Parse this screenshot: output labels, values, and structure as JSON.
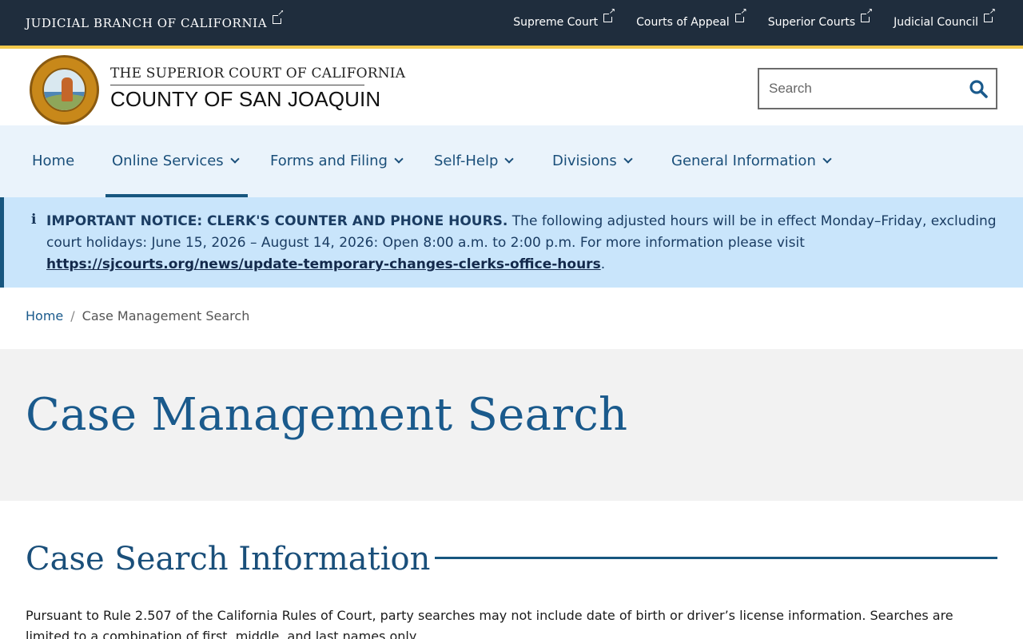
{
  "topbar": {
    "branch": "JUDICIAL BRANCH OF CALIFORNIA",
    "links": [
      "Supreme Court",
      "Courts of Appeal",
      "Superior Courts",
      "Judicial Council"
    ]
  },
  "header": {
    "court_line1": "THE SUPERIOR COURT OF CALIFORNIA",
    "court_line2": "COUNTY OF SAN JOAQUIN",
    "search_placeholder": "Search"
  },
  "nav": {
    "items": [
      "Home",
      "Online Services",
      "Forms and Filing",
      "Self-Help",
      "Divisions",
      "General Information"
    ],
    "active": "Online Services"
  },
  "alert": {
    "icon": "info-icon",
    "heading": "IMPORTANT NOTICE: CLERK'S COUNTER AND PHONE HOURS.",
    "text": " The following adjusted hours will be in effect Monday–Friday, excluding court holi­days: June 15, 2026 – August 14, 2026: Open 8:00 a.m. to 2:00 p.m. For more information please visit ",
    "link": "https://sjcourts.org/news/update-temporary-changes-clerks-office-hours",
    "tail": "."
  },
  "breadcrumb": {
    "home": "Home",
    "separator": "/",
    "current": "Case Management Search"
  },
  "page": {
    "title": "Case Management Search",
    "section_title": "Case Search Information",
    "body": "Pursuant to Rule 2.507 of the California Rules of Court, party searches may not include date of birth or driver’s license information. Searches are limited to a combina­tion of first, middle, and last names only."
  },
  "colors": {
    "topbar_bg": "#1f2d3d",
    "accent_gold": "#f2c94c",
    "nav_bg": "#eaf3fb",
    "alert_bg": "#c9e5fb",
    "primary_blue": "#1a5a8c",
    "hero_bg": "#f2f2f2"
  }
}
